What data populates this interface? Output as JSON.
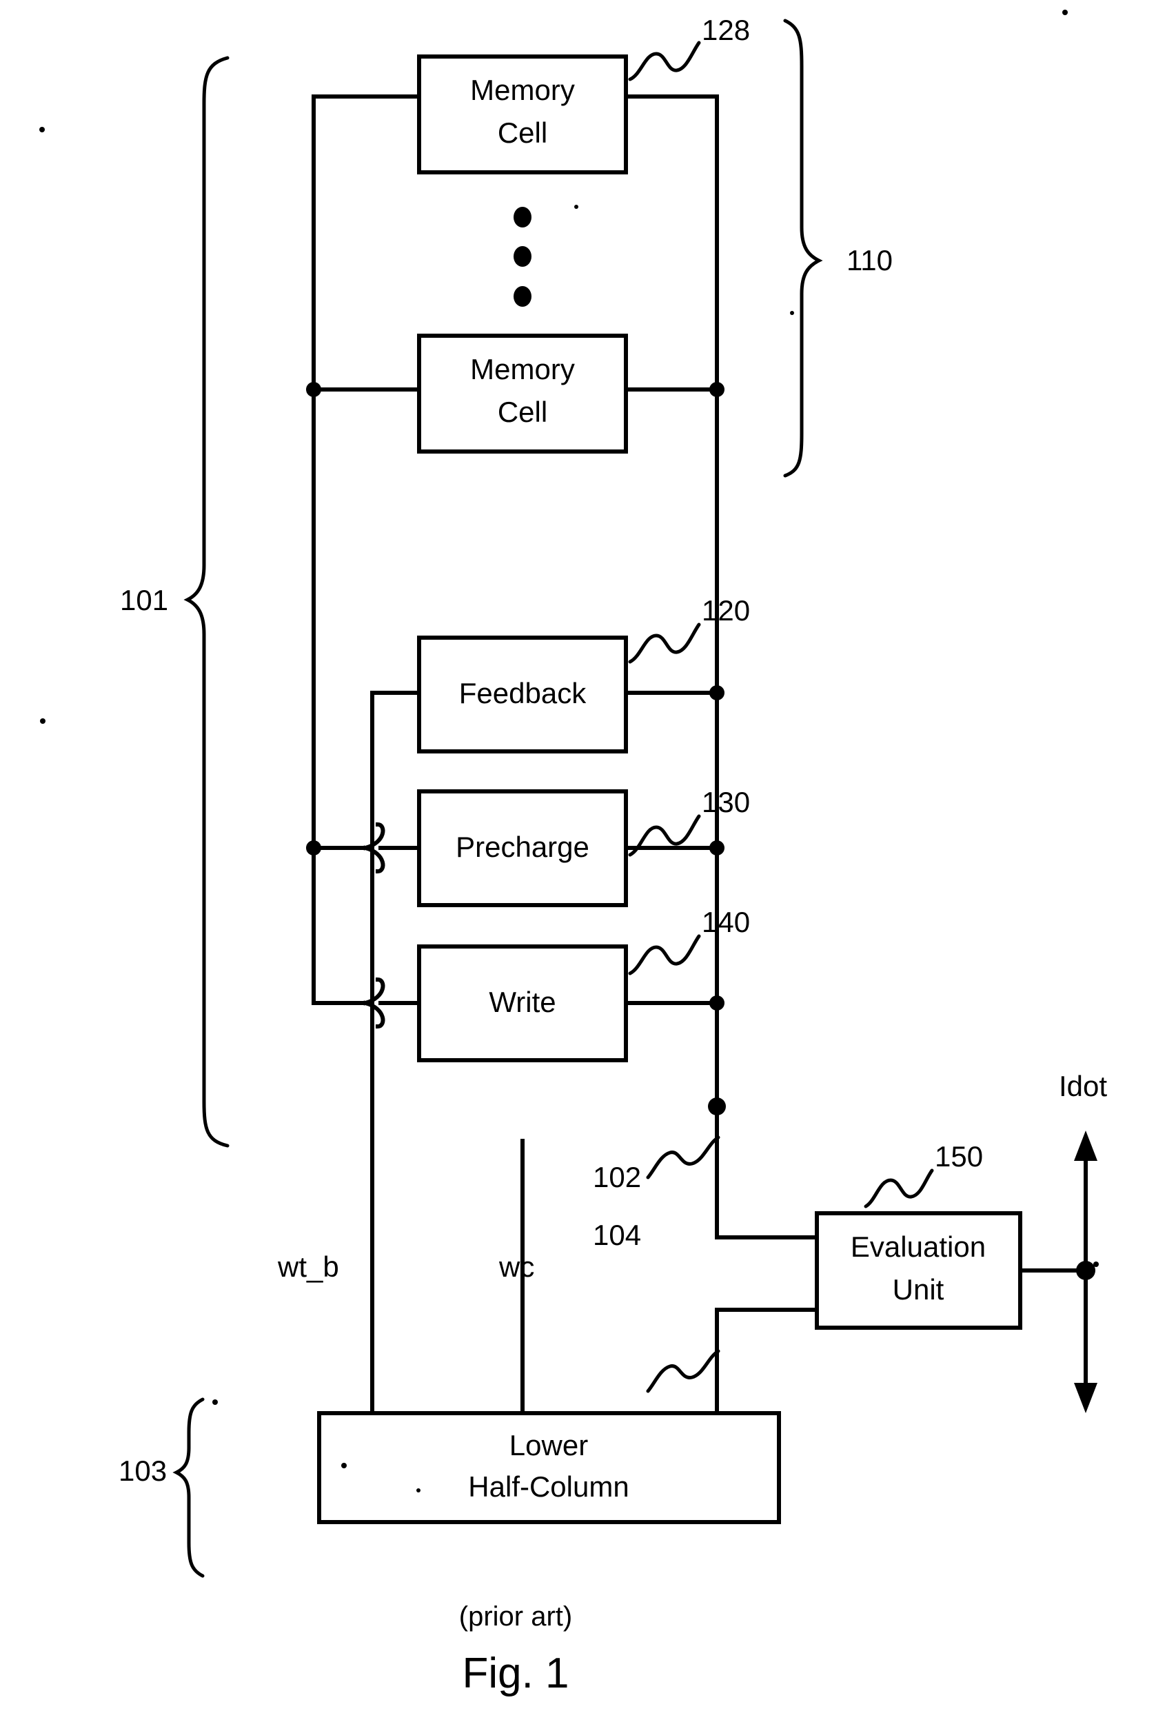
{
  "figure": {
    "caption_note": "(prior art)",
    "caption_title": "Fig. 1"
  },
  "blocks": [
    {
      "id": "memory-cell-top",
      "line1": "Memory",
      "line2": "Cell"
    },
    {
      "id": "memory-cell-bottom",
      "line1": "Memory",
      "line2": "Cell"
    },
    {
      "id": "feedback",
      "line1": "Feedback",
      "line2": ""
    },
    {
      "id": "precharge",
      "line1": "Precharge",
      "line2": ""
    },
    {
      "id": "write",
      "line1": "Write",
      "line2": ""
    },
    {
      "id": "evaluation-unit",
      "line1": "Evaluation",
      "line2": "Unit"
    },
    {
      "id": "lower-half-column",
      "line1": "Lower",
      "line2": "Half-Column"
    }
  ],
  "reference_numerals": {
    "memory_cell": "128",
    "memory_array": "110",
    "column": "101",
    "feedback": "120",
    "precharge": "130",
    "write": "140",
    "evaluation_unit": "150",
    "bitline_true": "102",
    "bitline_complement": "104",
    "lower_half_column": "103"
  },
  "signals": {
    "write_true_bar": "wt_b",
    "write_complement": "wc",
    "output_current": "Idot"
  },
  "colors": {
    "ink": "#000000",
    "paper": "#ffffff"
  }
}
